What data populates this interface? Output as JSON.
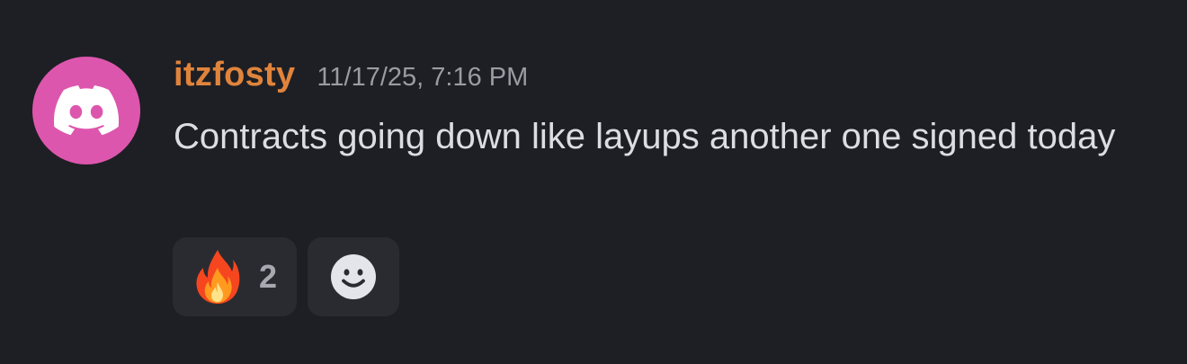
{
  "message": {
    "author": {
      "username": "itzfosty",
      "avatar_icon": "discord-logo-icon",
      "avatar_color": "#dd56ad",
      "username_color": "#e0843c"
    },
    "timestamp": "11/17/25, 7:16 PM",
    "content": "Contracts going down like layups another one signed today",
    "reactions": [
      {
        "emoji_icon": "fire-emoji-icon",
        "count": "2"
      }
    ],
    "add_reaction_icon": "smiley-face-icon"
  }
}
